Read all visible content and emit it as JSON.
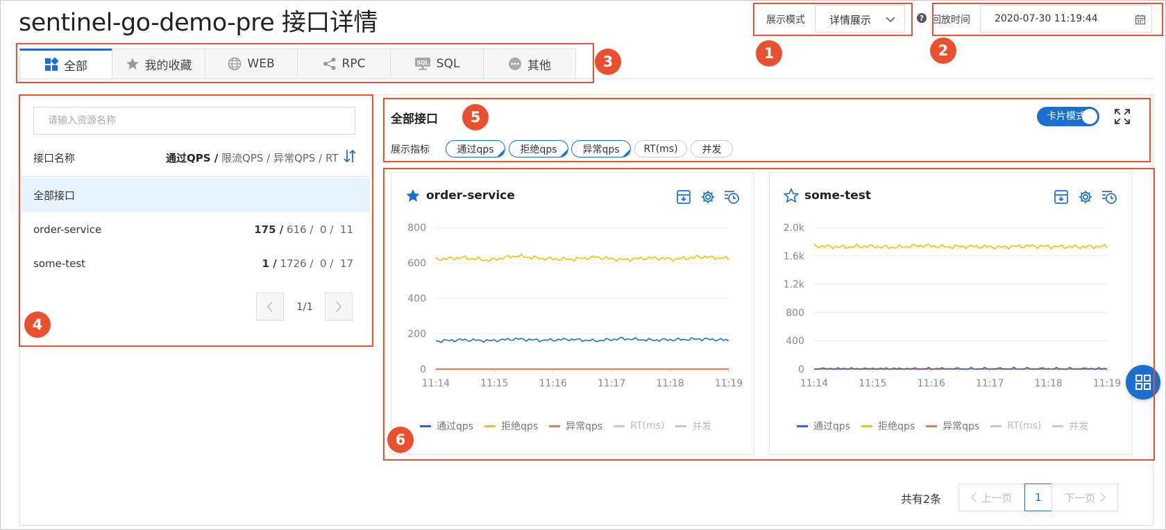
{
  "page": {
    "title": "sentinel-go-demo-pre 接口详情"
  },
  "header": {
    "display_mode_label": "展示模式",
    "display_mode_value": "详情展示",
    "replay_label": "回放时间",
    "replay_value": "2020-07-30 11:19:44"
  },
  "annotations": [
    "1",
    "2",
    "3",
    "4",
    "5",
    "6"
  ],
  "tabs": [
    {
      "label": "全部",
      "icon": "dashboard-icon",
      "active": true
    },
    {
      "label": "我的收藏",
      "icon": "star-icon"
    },
    {
      "label": "WEB",
      "icon": "globe-icon"
    },
    {
      "label": "RPC",
      "icon": "share-icon"
    },
    {
      "label": "SQL",
      "icon": "sql-icon"
    },
    {
      "label": "其他",
      "icon": "more-icon"
    }
  ],
  "resources": {
    "search_placeholder": "请输入资源名称",
    "col_name": "接口名称",
    "col_metrics_bold": "通过QPS /",
    "col_metrics_rest": "限流QPS / 异常QPS / RT",
    "rows": [
      {
        "name": "全部接口",
        "selected": true
      },
      {
        "name": "order-service",
        "pass": "175 /",
        "rest": "616 /  0 /  11"
      },
      {
        "name": "some-test",
        "pass": "1 /",
        "rest": "1726 /  0 /  17"
      }
    ],
    "page_indicator": "1/1"
  },
  "main": {
    "section_title": "全部接口",
    "card_mode_label": "卡片模式",
    "metrics_label": "展示指标",
    "metric_chips": [
      {
        "label": "通过qps",
        "on": true
      },
      {
        "label": "拒绝qps",
        "on": true
      },
      {
        "label": "异常qps",
        "on": true
      },
      {
        "label": "RT(ms)",
        "on": false
      },
      {
        "label": "并发",
        "on": false
      }
    ]
  },
  "legend": [
    {
      "label": "通过qps",
      "color": "#1a6fd1",
      "active": true
    },
    {
      "label": "拒绝qps",
      "color": "#f5c000",
      "active": true
    },
    {
      "label": "异常qps",
      "color": "#f07a4a",
      "active": true
    },
    {
      "label": "RT(ms)",
      "color": "#c8c8c8",
      "active": false
    },
    {
      "label": "并发",
      "color": "#c8c8c8",
      "active": false
    }
  ],
  "pagination": {
    "total": "共有2条",
    "prev": "上一页",
    "current": "1",
    "next": "下一页"
  },
  "chart_data": [
    {
      "type": "line",
      "title": "order-service",
      "favorited": true,
      "x": [
        "11:14",
        "11:15",
        "11:16",
        "11:17",
        "11:18",
        "11:19"
      ],
      "y_ticks": [
        "0",
        "200",
        "400",
        "600",
        "800"
      ],
      "ylim": [
        0,
        800
      ],
      "series": [
        {
          "name": "通过qps",
          "color": "#1a6fd1",
          "values": [
            158,
            165,
            160,
            170,
            162,
            168,
            160,
            172,
            164,
            166,
            170,
            163
          ]
        },
        {
          "name": "拒绝qps",
          "color": "#f5c000",
          "values": [
            620,
            630,
            615,
            640,
            625,
            620,
            632,
            618,
            628,
            622,
            635,
            624
          ]
        },
        {
          "name": "异常qps",
          "color": "#f07a4a",
          "values": [
            0,
            0,
            0,
            0,
            0,
            0,
            0,
            0,
            0,
            0,
            0,
            0
          ]
        }
      ]
    },
    {
      "type": "line",
      "title": "some-test",
      "favorited": false,
      "x": [
        "11:14",
        "11:15",
        "11:16",
        "11:17",
        "11:18",
        "11:19"
      ],
      "y_ticks": [
        "0",
        "400",
        "800",
        "1.2k",
        "1.6k",
        "2.0k"
      ],
      "ylim": [
        0,
        2000
      ],
      "series": [
        {
          "name": "通过qps",
          "color": "#1a6fd1",
          "values": [
            1,
            1,
            1,
            1,
            1,
            1,
            1,
            1,
            1,
            1,
            1,
            1
          ]
        },
        {
          "name": "拒绝qps",
          "color": "#f5c000",
          "values": [
            1740,
            1725,
            1735,
            1720,
            1745,
            1728,
            1732,
            1722,
            1740,
            1730,
            1726,
            1734
          ]
        },
        {
          "name": "异常qps",
          "color": "#f07a4a",
          "values": [
            0,
            0,
            0,
            0,
            0,
            0,
            0,
            0,
            0,
            0,
            0,
            0
          ]
        }
      ]
    }
  ]
}
